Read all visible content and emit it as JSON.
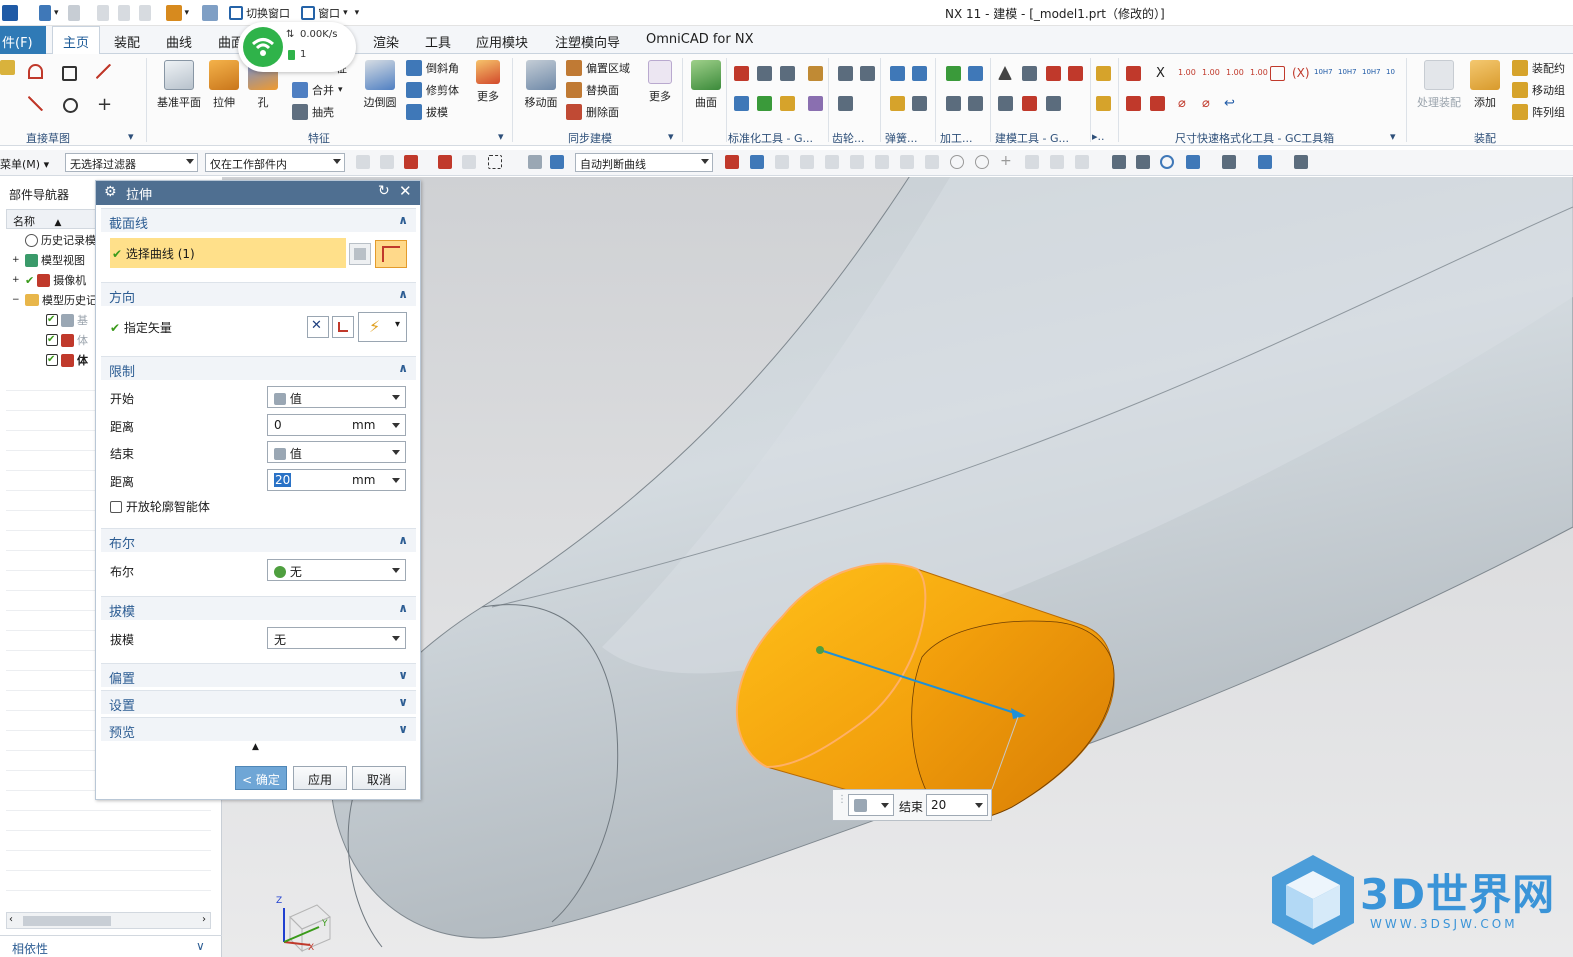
{
  "window": {
    "title": "NX 11 - 建模 - [_model1.prt（修改的）]"
  },
  "quick_access": {
    "switch_window": "切换窗口",
    "window": "窗口"
  },
  "network_widget": {
    "speed": "0.00K/s",
    "count": "1"
  },
  "menu": {
    "file": "件(F)",
    "tabs": [
      "主页",
      "装配",
      "曲线",
      "曲面",
      "渲染",
      "工具",
      "应用模块",
      "注塑模向导",
      "OmniCAD for NX"
    ]
  },
  "ribbon": {
    "direct_sketch": {
      "label": "直接草图"
    },
    "feature": {
      "label": "特征",
      "buttons": [
        "基准平面",
        "拉伸",
        "孔",
        "边倒圆",
        "更多"
      ],
      "small": [
        "合并",
        "抽壳",
        "倒斜角",
        "修剪体",
        "拔模"
      ],
      "partial": "征"
    },
    "sync": {
      "label": "同步建模",
      "buttons": [
        "移动面",
        "更多"
      ],
      "small": [
        "偏置区域",
        "替换面",
        "删除面"
      ]
    },
    "surface": {
      "button": "曲面"
    },
    "groups": [
      "标准化工具 - G...",
      "齿轮...",
      "弹簧...",
      "加工...",
      "建模工具 - G...",
      "尺寸快速格式化工具 - GC工具箱",
      "装配"
    ],
    "assembly": {
      "buttons": [
        "处理装配",
        "添加"
      ],
      "small": [
        "装配约",
        "移动组",
        "阵列组"
      ]
    },
    "dim_labels": [
      "1.00",
      "1.00",
      "1.00",
      "1.00",
      "10H7",
      "10H7",
      "10H7",
      "10"
    ]
  },
  "filterbar": {
    "menu": "菜单(M)",
    "filter": "无选择过滤器",
    "scope": "仅在工作部件内",
    "curve_rule": "自动判断曲线"
  },
  "navigator": {
    "title": "部件导航器",
    "column": "名称",
    "items": [
      {
        "label": "历史记录模"
      },
      {
        "label": "模型视图"
      },
      {
        "label": "摄像机"
      },
      {
        "label": "模型历史记"
      },
      {
        "label": "基"
      },
      {
        "label": "体"
      },
      {
        "label": "体"
      }
    ],
    "footer": "相依性"
  },
  "dialog": {
    "title": "拉伸",
    "section_curve": {
      "title": "截面线",
      "select": "选择曲线 (1)"
    },
    "direction": {
      "title": "方向",
      "vector": "指定矢量"
    },
    "limits": {
      "title": "限制",
      "start_label": "开始",
      "start_value": "值",
      "start_dist_label": "距离",
      "start_dist": "0",
      "start_unit": "mm",
      "end_label": "结束",
      "end_value": "值",
      "end_dist_label": "距离",
      "end_dist": "20",
      "end_unit": "mm",
      "open_profile": "开放轮廓智能体"
    },
    "boolean": {
      "title": "布尔",
      "label": "布尔",
      "value": "无"
    },
    "draft": {
      "title": "拔模",
      "label": "拔模",
      "value": "无"
    },
    "collapsed": [
      "偏置",
      "设置",
      "预览"
    ],
    "buttons": {
      "ok": "< 确定 >",
      "apply": "应用",
      "cancel": "取消"
    }
  },
  "onscreen_input": {
    "label": "结束",
    "value": "20"
  },
  "watermark": {
    "text": "3D世界网",
    "url": "WWW.3DSJW.COM"
  },
  "triad": {
    "x": "X",
    "y": "Y",
    "z": "Z"
  }
}
